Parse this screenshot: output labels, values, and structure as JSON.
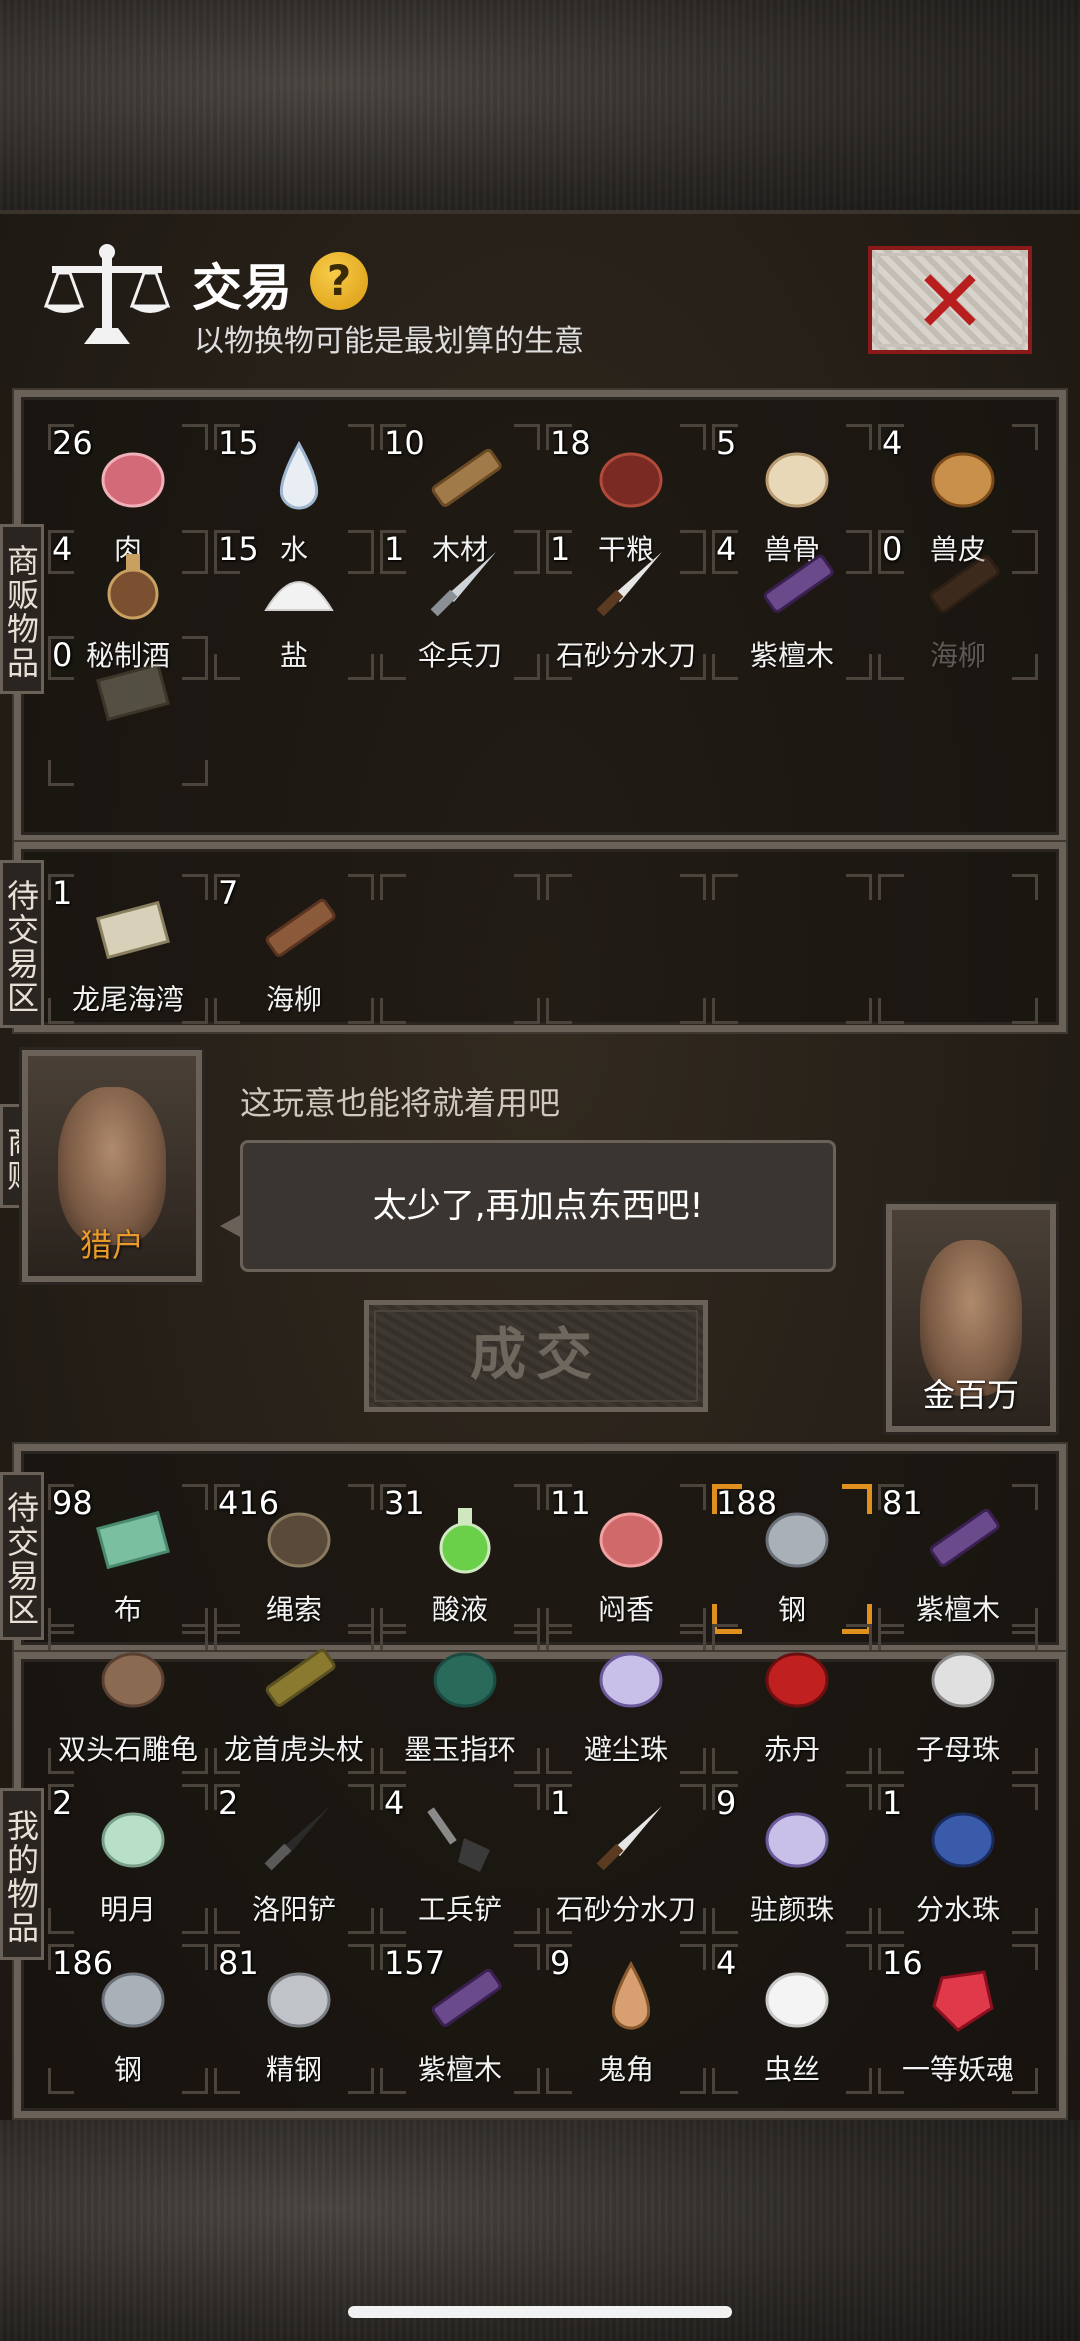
{
  "header": {
    "title": "交易",
    "help": "?",
    "subtitle": "以物换物可能是最划算的生意",
    "close": "✕"
  },
  "tabs": {
    "merchant_goods": "商贩物品",
    "pending_top": "待交易区",
    "merchant": "商贩",
    "pending_bottom": "待交易区",
    "my_goods": "我的物品"
  },
  "merchant_goods": [
    {
      "count": "26",
      "name": "肉",
      "icon": "meat-icon"
    },
    {
      "count": "15",
      "name": "水",
      "icon": "water-drop-icon"
    },
    {
      "count": "10",
      "name": "木材",
      "icon": "wood-icon"
    },
    {
      "count": "18",
      "name": "干粮",
      "icon": "jerky-icon"
    },
    {
      "count": "5",
      "name": "兽骨",
      "icon": "bone-icon"
    },
    {
      "count": "4",
      "name": "兽皮",
      "icon": "hide-icon"
    },
    {
      "count": "4",
      "name": "秘制酒",
      "icon": "wine-jar-icon"
    },
    {
      "count": "15",
      "name": "盐",
      "icon": "salt-icon"
    },
    {
      "count": "1",
      "name": "伞兵刀",
      "icon": "knife-icon"
    },
    {
      "count": "1",
      "name": "石砂分水刀",
      "icon": "blade-icon"
    },
    {
      "count": "4",
      "name": "紫檀木",
      "icon": "rosewood-icon"
    },
    {
      "count": "0",
      "name": "海柳",
      "icon": "driftwood-icon"
    },
    {
      "count": "0",
      "name": "",
      "icon": "map-icon"
    }
  ],
  "merchant_pending": [
    {
      "count": "1",
      "name": "龙尾海湾",
      "icon": "map-icon"
    },
    {
      "count": "7",
      "name": "海柳",
      "icon": "driftwood-icon"
    }
  ],
  "merchant": {
    "name": "猎户",
    "quote": "这玩意也能将就着用吧",
    "reply": "太少了,再加点东西吧!"
  },
  "player": {
    "name": "金百万",
    "stars": "★★"
  },
  "deal_button": "成交",
  "my_pending": [
    {
      "count": "98",
      "name": "布",
      "icon": "cloth-icon"
    },
    {
      "count": "416",
      "name": "绳索",
      "icon": "rope-icon"
    },
    {
      "count": "31",
      "name": "酸液",
      "icon": "acid-flask-icon"
    },
    {
      "count": "11",
      "name": "闷香",
      "icon": "incense-icon"
    },
    {
      "count": "188",
      "name": "钢",
      "icon": "steel-icon",
      "selected": true
    },
    {
      "count": "81",
      "name": "紫檀木",
      "icon": "rosewood-icon"
    }
  ],
  "my_goods": [
    {
      "count": "",
      "name": "双头石雕龟",
      "icon": "stone-turtle-icon"
    },
    {
      "count": "",
      "name": "龙首虎头杖",
      "icon": "staff-icon"
    },
    {
      "count": "",
      "name": "墨玉指环",
      "icon": "jade-ring-icon"
    },
    {
      "count": "",
      "name": "避尘珠",
      "icon": "pearl-icon"
    },
    {
      "count": "",
      "name": "赤丹",
      "icon": "red-pill-icon"
    },
    {
      "count": "",
      "name": "子母珠",
      "icon": "orb-icon"
    },
    {
      "count": "2",
      "name": "明月",
      "icon": "earring-icon"
    },
    {
      "count": "2",
      "name": "洛阳铲",
      "icon": "luoyang-shovel-icon"
    },
    {
      "count": "4",
      "name": "工兵铲",
      "icon": "shovel-icon"
    },
    {
      "count": "1",
      "name": "石砂分水刀",
      "icon": "blade-icon"
    },
    {
      "count": "9",
      "name": "驻颜珠",
      "icon": "pearl-icon"
    },
    {
      "count": "1",
      "name": "分水珠",
      "icon": "blue-orb-icon"
    },
    {
      "count": "186",
      "name": "钢",
      "icon": "steel-icon"
    },
    {
      "count": "81",
      "name": "精钢",
      "icon": "fine-steel-icon"
    },
    {
      "count": "157",
      "name": "紫檀木",
      "icon": "rosewood-icon"
    },
    {
      "count": "9",
      "name": "鬼角",
      "icon": "horn-icon"
    },
    {
      "count": "4",
      "name": "虫丝",
      "icon": "silk-icon"
    },
    {
      "count": "16",
      "name": "一等妖魂",
      "icon": "red-gem-icon"
    }
  ]
}
